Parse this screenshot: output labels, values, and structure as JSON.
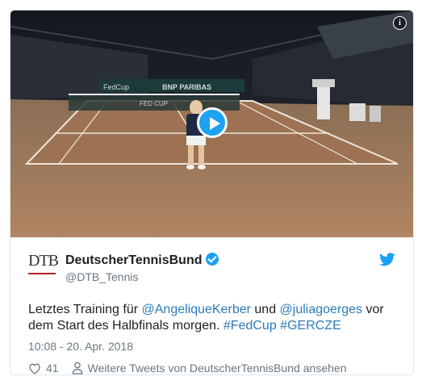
{
  "media": {
    "info_icon": "info-icon",
    "play_icon": "play-icon",
    "background_signs": [
      "FedCup",
      "BNP PARIBAS",
      "FED CUP"
    ]
  },
  "tweet": {
    "author_name": "DeutscherTennisBund",
    "handle": "@DTB_Tennis",
    "logo_text": "DTB",
    "text_prefix": "Letztes Training für ",
    "mention1": "@AngeliqueKerber",
    "text_and": " und ",
    "mention2": "@juliagoerges",
    "text_middle": " vor dem Start des Halbfinals morgen. ",
    "hashtag1": "#FedCup",
    "text_space": " ",
    "hashtag2": "#GERCZE",
    "timestamp": "10:08 - 20. Apr. 2018",
    "like_count": "41",
    "more_tweets": "Weitere Tweets von DeutscherTennisBund ansehen"
  },
  "colors": {
    "accent": "#1da1f2",
    "link": "#2b7bb9",
    "muted": "#697882",
    "text": "#1c2022"
  }
}
